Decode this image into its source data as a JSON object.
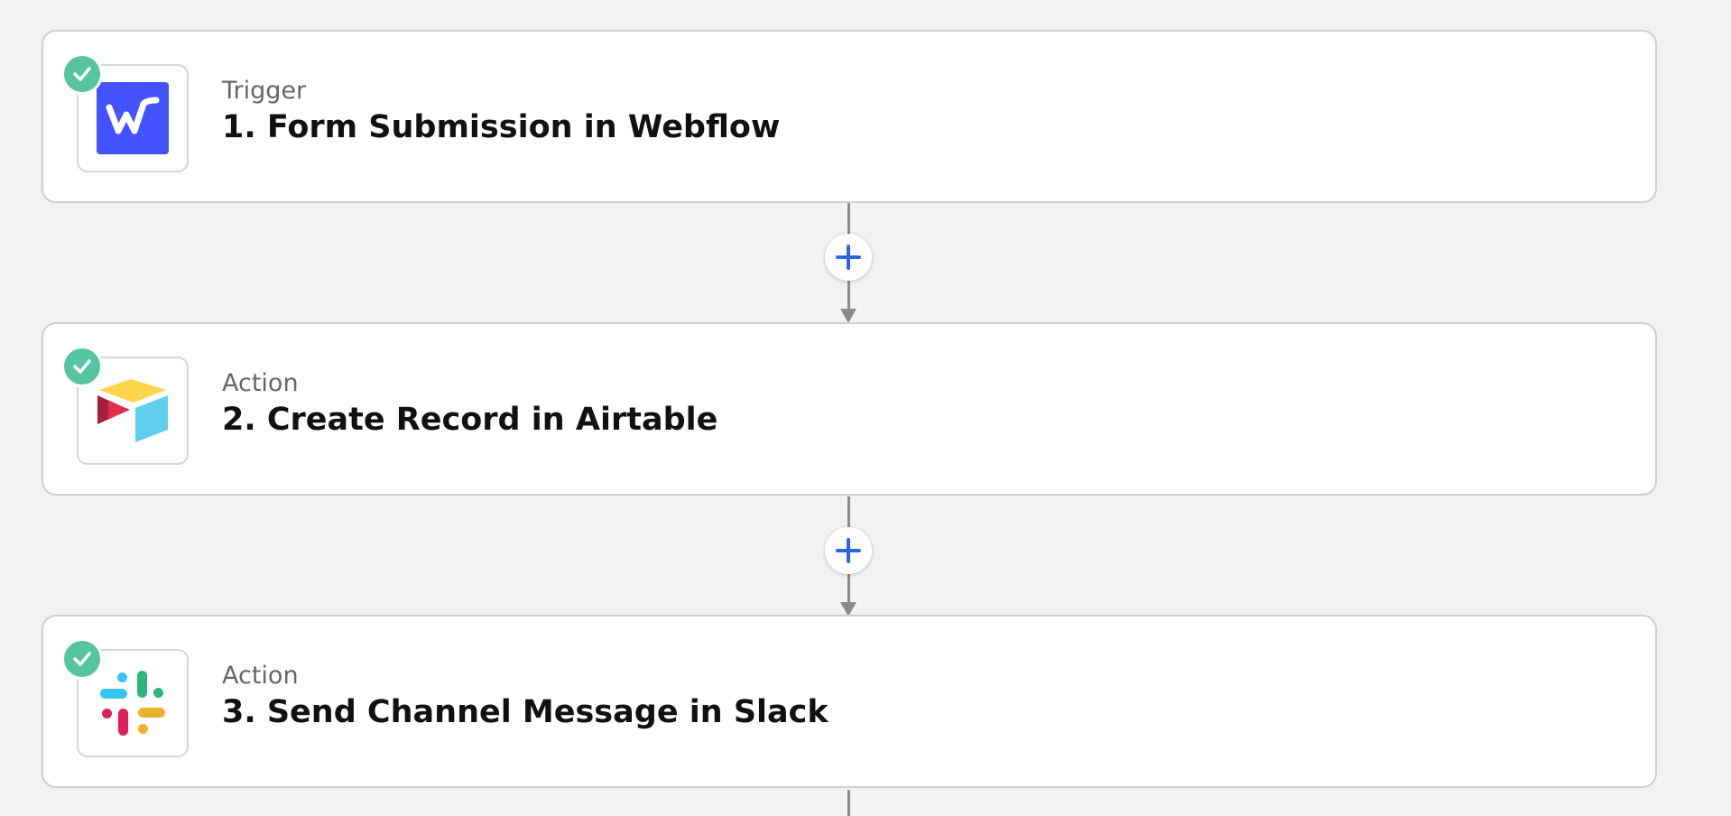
{
  "colors": {
    "background": "#f2f2f2",
    "card_border": "#cfcfcf",
    "connector": "#8a8a8a",
    "add_button_plus": "#2d63ea",
    "success_check": "#56c4a0",
    "webflow_brand": "#4353ff"
  },
  "steps": [
    {
      "type": "Trigger",
      "title": "1. Form Submission in Webflow",
      "app_icon": "webflow-icon",
      "status_icon": "check-circle-icon"
    },
    {
      "type": "Action",
      "title": "2. Create Record in Airtable",
      "app_icon": "airtable-icon",
      "status_icon": "check-circle-icon"
    },
    {
      "type": "Action",
      "title": "3. Send Channel Message in Slack",
      "app_icon": "slack-icon",
      "status_icon": "check-circle-icon"
    }
  ],
  "connectors": [
    {
      "button_icon": "plus-icon"
    },
    {
      "button_icon": "plus-icon"
    }
  ]
}
